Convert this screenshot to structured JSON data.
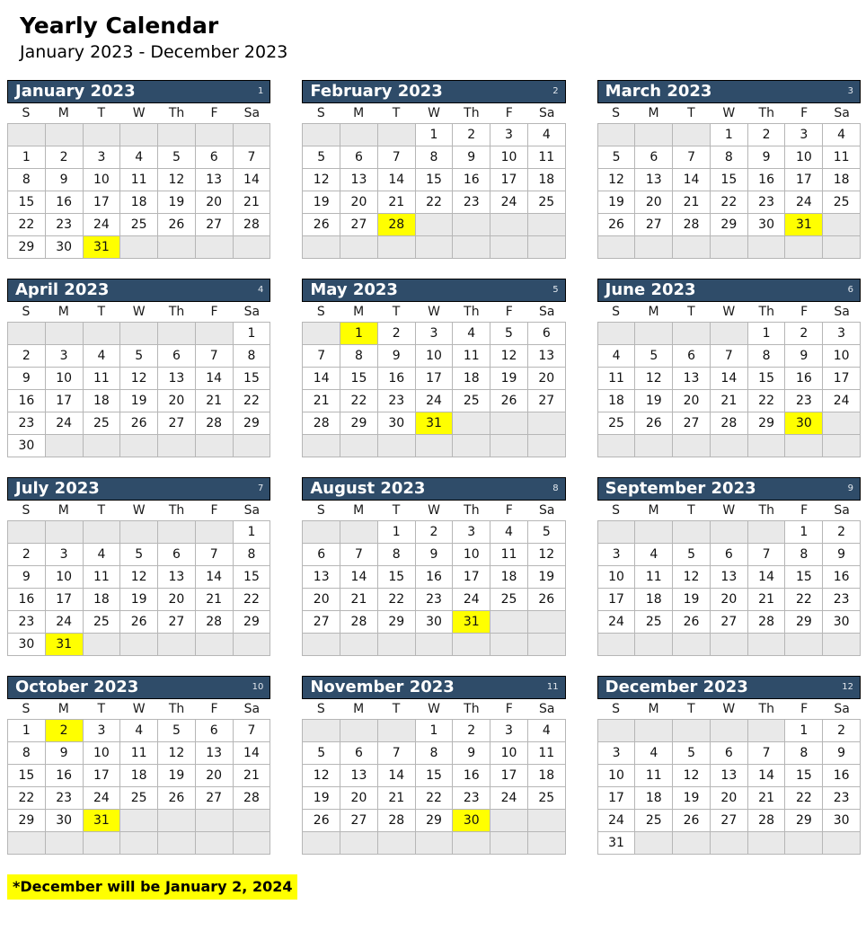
{
  "header": {
    "title": "Yearly Calendar",
    "subtitle": "January 2023 - December 2023"
  },
  "theme": {
    "header_bg": "#2f4c69",
    "header_text": "#ffffff",
    "highlight": "#ffff00",
    "blank_cell": "#e9e9e9",
    "grid_line": "#b6b6b6"
  },
  "weekdays": [
    "S",
    "M",
    "T",
    "W",
    "Th",
    "F",
    "Sa"
  ],
  "footnote": "*December will be January 2, 2024",
  "months": [
    {
      "name": "January 2023",
      "number": "1",
      "lead_blanks": 0,
      "days_in_month": 31,
      "highlighted": [
        31
      ],
      "cells": [
        "",
        "",
        "",
        "",
        "",
        "",
        "",
        "1",
        "2",
        "3",
        "4",
        "5",
        "6",
        "7",
        "8",
        "9",
        "10",
        "11",
        "12",
        "13",
        "14",
        "15",
        "16",
        "17",
        "18",
        "19",
        "20",
        "21",
        "22",
        "23",
        "24",
        "25",
        "26",
        "27",
        "28",
        "29",
        "30",
        "31",
        "",
        "",
        "",
        ""
      ]
    },
    {
      "name": "February 2023",
      "number": "2",
      "lead_blanks": 3,
      "days_in_month": 28,
      "highlighted": [
        28
      ],
      "cells": [
        "",
        "",
        "",
        "1",
        "2",
        "3",
        "4",
        "5",
        "6",
        "7",
        "8",
        "9",
        "10",
        "11",
        "12",
        "13",
        "14",
        "15",
        "16",
        "17",
        "18",
        "19",
        "20",
        "21",
        "22",
        "23",
        "24",
        "25",
        "26",
        "27",
        "28",
        "",
        "",
        "",
        "",
        "",
        "",
        "",
        "",
        "",
        "",
        ""
      ]
    },
    {
      "name": "March 2023",
      "number": "3",
      "lead_blanks": 3,
      "days_in_month": 31,
      "highlighted": [
        31
      ],
      "cells": [
        "",
        "",
        "",
        "1",
        "2",
        "3",
        "4",
        "5",
        "6",
        "7",
        "8",
        "9",
        "10",
        "11",
        "12",
        "13",
        "14",
        "15",
        "16",
        "17",
        "18",
        "19",
        "20",
        "21",
        "22",
        "23",
        "24",
        "25",
        "26",
        "27",
        "28",
        "29",
        "30",
        "31",
        "",
        "",
        "",
        "",
        "",
        "",
        "",
        ""
      ]
    },
    {
      "name": "April 2023",
      "number": "4",
      "lead_blanks": 6,
      "days_in_month": 30,
      "highlighted": [],
      "cells": [
        "",
        "",
        "",
        "",
        "",
        "",
        "1",
        "2",
        "3",
        "4",
        "5",
        "6",
        "7",
        "8",
        "9",
        "10",
        "11",
        "12",
        "13",
        "14",
        "15",
        "16",
        "17",
        "18",
        "19",
        "20",
        "21",
        "22",
        "23",
        "24",
        "25",
        "26",
        "27",
        "28",
        "29",
        "30",
        "",
        "",
        "",
        "",
        "",
        ""
      ]
    },
    {
      "name": "May 2023",
      "number": "5",
      "lead_blanks": 1,
      "days_in_month": 31,
      "highlighted": [
        1,
        31
      ],
      "cells": [
        "",
        "1",
        "2",
        "3",
        "4",
        "5",
        "6",
        "7",
        "8",
        "9",
        "10",
        "11",
        "12",
        "13",
        "14",
        "15",
        "16",
        "17",
        "18",
        "19",
        "20",
        "21",
        "22",
        "23",
        "24",
        "25",
        "26",
        "27",
        "28",
        "29",
        "30",
        "31",
        "",
        "",
        "",
        "",
        "",
        "",
        "",
        "",
        "",
        ""
      ]
    },
    {
      "name": "June 2023",
      "number": "6",
      "lead_blanks": 4,
      "days_in_month": 30,
      "highlighted": [
        30
      ],
      "cells": [
        "",
        "",
        "",
        "",
        "1",
        "2",
        "3",
        "4",
        "5",
        "6",
        "7",
        "8",
        "9",
        "10",
        "11",
        "12",
        "13",
        "14",
        "15",
        "16",
        "17",
        "18",
        "19",
        "20",
        "21",
        "22",
        "23",
        "24",
        "25",
        "26",
        "27",
        "28",
        "29",
        "30",
        "",
        "",
        "",
        "",
        "",
        "",
        "",
        ""
      ]
    },
    {
      "name": "July 2023",
      "number": "7",
      "lead_blanks": 6,
      "days_in_month": 31,
      "highlighted": [
        31
      ],
      "cells": [
        "",
        "",
        "",
        "",
        "",
        "",
        "1",
        "2",
        "3",
        "4",
        "5",
        "6",
        "7",
        "8",
        "9",
        "10",
        "11",
        "12",
        "13",
        "14",
        "15",
        "16",
        "17",
        "18",
        "19",
        "20",
        "21",
        "22",
        "23",
        "24",
        "25",
        "26",
        "27",
        "28",
        "29",
        "30",
        "31",
        "",
        "",
        "",
        "",
        ""
      ]
    },
    {
      "name": "August 2023",
      "number": "8",
      "lead_blanks": 2,
      "days_in_month": 31,
      "highlighted": [
        31
      ],
      "cells": [
        "",
        "",
        "1",
        "2",
        "3",
        "4",
        "5",
        "6",
        "7",
        "8",
        "9",
        "10",
        "11",
        "12",
        "13",
        "14",
        "15",
        "16",
        "17",
        "18",
        "19",
        "20",
        "21",
        "22",
        "23",
        "24",
        "25",
        "26",
        "27",
        "28",
        "29",
        "30",
        "31",
        "",
        "",
        "",
        "",
        "",
        "",
        "",
        "",
        ""
      ]
    },
    {
      "name": "September 2023",
      "number": "9",
      "lead_blanks": 5,
      "days_in_month": 30,
      "highlighted": [],
      "cells": [
        "",
        "",
        "",
        "",
        "",
        "1",
        "2",
        "3",
        "4",
        "5",
        "6",
        "7",
        "8",
        "9",
        "10",
        "11",
        "12",
        "13",
        "14",
        "15",
        "16",
        "17",
        "18",
        "19",
        "20",
        "21",
        "22",
        "23",
        "24",
        "25",
        "26",
        "27",
        "28",
        "29",
        "30",
        "",
        "",
        "",
        "",
        "",
        "",
        ""
      ]
    },
    {
      "name": "October 2023",
      "number": "10",
      "lead_blanks": 0,
      "days_in_month": 31,
      "highlighted": [
        2,
        31
      ],
      "cells": [
        "1",
        "2",
        "3",
        "4",
        "5",
        "6",
        "7",
        "8",
        "9",
        "10",
        "11",
        "12",
        "13",
        "14",
        "15",
        "16",
        "17",
        "18",
        "19",
        "20",
        "21",
        "22",
        "23",
        "24",
        "25",
        "26",
        "27",
        "28",
        "29",
        "30",
        "31",
        "",
        "",
        "",
        "",
        "",
        "",
        "",
        "",
        "",
        "",
        ""
      ]
    },
    {
      "name": "November 2023",
      "number": "11",
      "lead_blanks": 3,
      "days_in_month": 30,
      "highlighted": [
        30
      ],
      "cells": [
        "",
        "",
        "",
        "1",
        "2",
        "3",
        "4",
        "5",
        "6",
        "7",
        "8",
        "9",
        "10",
        "11",
        "12",
        "13",
        "14",
        "15",
        "16",
        "17",
        "18",
        "19",
        "20",
        "21",
        "22",
        "23",
        "24",
        "25",
        "26",
        "27",
        "28",
        "29",
        "30",
        "",
        "",
        "",
        "",
        "",
        "",
        "",
        "",
        ""
      ]
    },
    {
      "name": "December 2023",
      "number": "12",
      "lead_blanks": 5,
      "days_in_month": 31,
      "highlighted": [],
      "cells": [
        "",
        "",
        "",
        "",
        "",
        "1",
        "2",
        "3",
        "4",
        "5",
        "6",
        "7",
        "8",
        "9",
        "10",
        "11",
        "12",
        "13",
        "14",
        "15",
        "16",
        "17",
        "18",
        "19",
        "20",
        "21",
        "22",
        "23",
        "24",
        "25",
        "26",
        "27",
        "28",
        "29",
        "30",
        "31",
        "",
        "",
        "",
        "",
        "",
        ""
      ]
    }
  ]
}
